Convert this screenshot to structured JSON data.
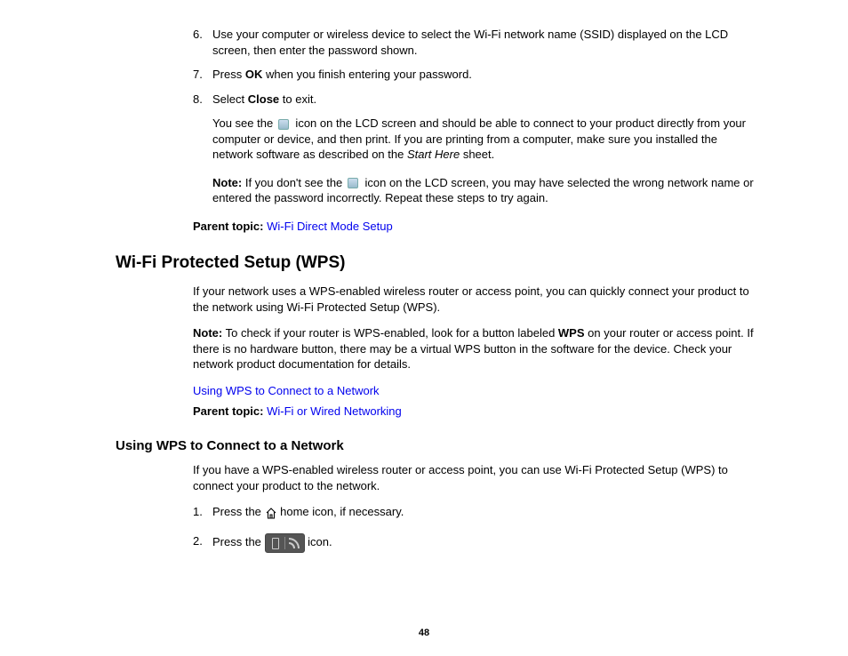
{
  "list": {
    "i6": {
      "num": "6.",
      "text_a": "Use your computer or wireless device to select the Wi-Fi network name (SSID) displayed on the LCD screen, then enter the password shown."
    },
    "i7": {
      "num": "7.",
      "prefix": "Press ",
      "bold": "OK",
      "suffix": " when you finish entering your password."
    },
    "i8": {
      "num": "8.",
      "prefix": "Select ",
      "bold": "Close",
      "suffix": " to exit."
    }
  },
  "after8": {
    "a": "You see the ",
    "b": " icon on the LCD screen and should be able to connect to your product directly from your computer or device, and then print. If you are printing from a computer, make sure you installed the network software as described on the ",
    "italic": "Start Here",
    "c": " sheet."
  },
  "note1": {
    "label": "Note:",
    "a": " If you don't see the ",
    "b": " icon on the LCD screen, you may have selected the wrong network name or entered the password incorrectly. Repeat these steps to try again."
  },
  "parent1": {
    "label": "Parent topic: ",
    "link": "Wi-Fi Direct Mode Setup"
  },
  "h2": "Wi-Fi Protected Setup (WPS)",
  "wps_intro": "If your network uses a WPS-enabled wireless router or access point, you can quickly connect your product to the network using Wi-Fi Protected Setup (WPS).",
  "note2": {
    "label": "Note:",
    "a": " To check if your router is WPS-enabled, look for a button labeled ",
    "bold": "WPS",
    "b": " on your router or access point. If there is no hardware button, there may be a virtual WPS button in the software for the device. Check your network product documentation for details."
  },
  "topiclink": "Using WPS to Connect to a Network",
  "parent2": {
    "label": "Parent topic: ",
    "link": "Wi-Fi or Wired Networking"
  },
  "h3": "Using WPS to Connect to a Network",
  "wps_body": "If you have a WPS-enabled wireless router or access point, you can use Wi-Fi Protected Setup (WPS) to connect your product to the network.",
  "step1": {
    "num": "1.",
    "a": "Press the ",
    "b": " home icon, if necessary."
  },
  "step2": {
    "num": "2.",
    "a": "Press the ",
    "b": " icon."
  },
  "page": "48"
}
